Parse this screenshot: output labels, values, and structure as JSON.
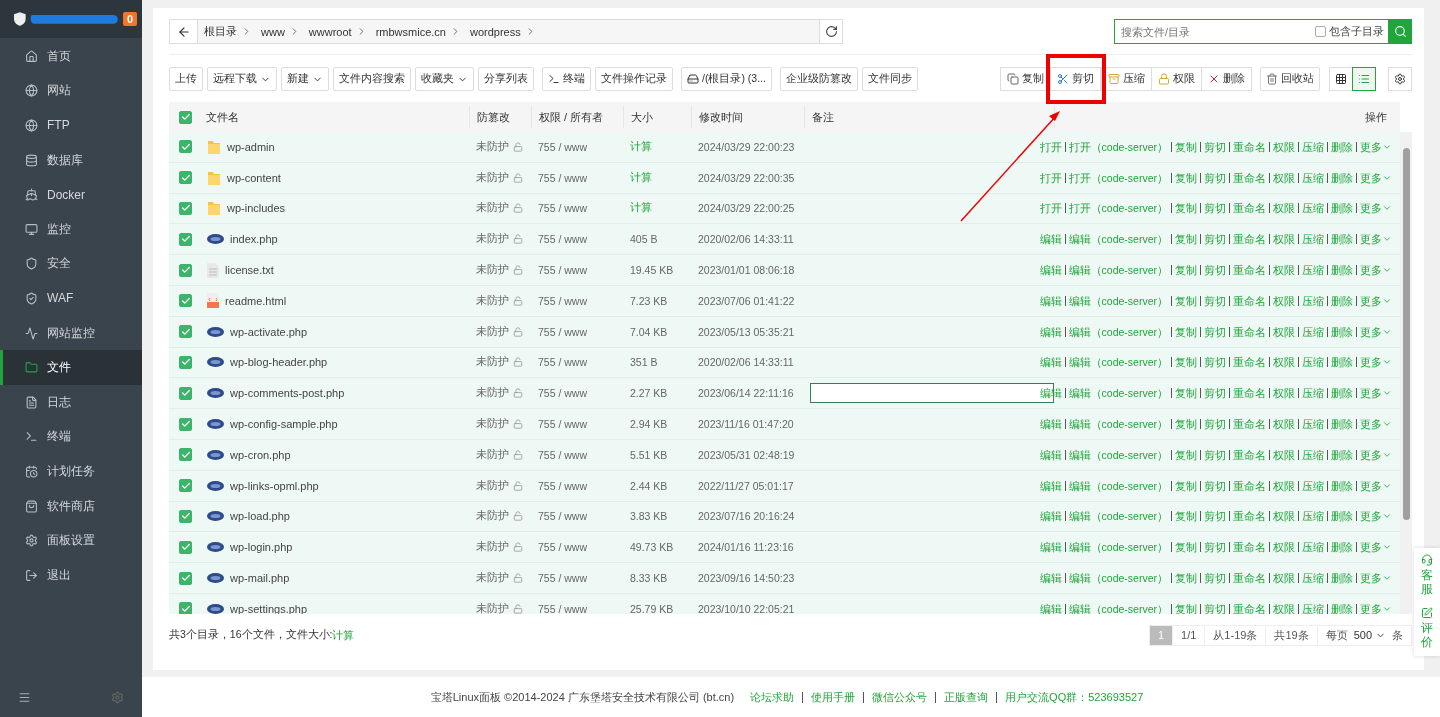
{
  "sidebar": {
    "badge": "0",
    "items": [
      {
        "label": "首页",
        "selected": false
      },
      {
        "label": "网站",
        "selected": false
      },
      {
        "label": "FTP",
        "selected": false
      },
      {
        "label": "数据库",
        "selected": false
      },
      {
        "label": "Docker",
        "selected": false
      },
      {
        "label": "监控",
        "selected": false
      },
      {
        "label": "安全",
        "selected": false
      },
      {
        "label": "WAF",
        "selected": false
      },
      {
        "label": "网站监控",
        "selected": false
      },
      {
        "label": "文件",
        "selected": true
      },
      {
        "label": "日志",
        "selected": false
      },
      {
        "label": "终端",
        "selected": false
      },
      {
        "label": "计划任务",
        "selected": false
      },
      {
        "label": "软件商店",
        "selected": false
      },
      {
        "label": "面板设置",
        "selected": false
      },
      {
        "label": "退出",
        "selected": false
      }
    ]
  },
  "breadcrumb": [
    "根目录",
    "www",
    "wwwroot",
    "rmbwsmice.cn",
    "wordpress"
  ],
  "search": {
    "placeholder": "搜索文件/目录",
    "include_subdirs": {
      "label": "包含子目录",
      "checked": false
    }
  },
  "toolbar": {
    "left": [
      {
        "label": "上传",
        "kind": "plain"
      },
      {
        "label": "远程下载",
        "kind": "dropdown"
      },
      {
        "label": "新建",
        "kind": "dropdown"
      },
      {
        "label": "文件内容搜索",
        "kind": "plain"
      },
      {
        "label": "收藏夹",
        "kind": "dropdown"
      },
      {
        "label": "分享列表",
        "kind": "plain"
      },
      {
        "label": "终端",
        "kind": "terminal"
      },
      {
        "label": "文件操作记录",
        "kind": "plain"
      },
      {
        "label": "/(根目录) (3...",
        "kind": "disk"
      },
      {
        "label": "企业级防篡改",
        "kind": "plain"
      },
      {
        "label": "文件同步",
        "kind": "plain"
      }
    ],
    "right": [
      {
        "label": "复制",
        "kind": "copy",
        "highlighted": false
      },
      {
        "label": "剪切",
        "kind": "cut",
        "highlighted": true
      },
      {
        "label": "压缩",
        "kind": "zip",
        "highlighted": false
      },
      {
        "label": "权限",
        "kind": "lock",
        "highlighted": false
      },
      {
        "label": "删除",
        "kind": "delete",
        "highlighted": false
      }
    ],
    "recycle": "回收站",
    "views": [
      {
        "kind": "grid",
        "selected": false
      },
      {
        "kind": "list",
        "selected": true
      }
    ]
  },
  "table": {
    "all_checked": true,
    "columns": [
      "文件名",
      "防篡改",
      "权限 / 所有者",
      "大小",
      "修改时间",
      "备注",
      "操作"
    ],
    "rows": [
      {
        "name": "wp-admin",
        "kind": "folder",
        "checked": true,
        "editing": false,
        "protect": "未防护",
        "perm": "755 / www",
        "size": "计算",
        "mtime": "2024/03/29 22:00:23",
        "actions": [
          "打开",
          "打开（code-server）",
          "复制",
          "剪切",
          "重命名",
          "权限",
          "压缩",
          "删除",
          "更多"
        ]
      },
      {
        "name": "wp-content",
        "kind": "folder",
        "checked": true,
        "editing": false,
        "protect": "未防护",
        "perm": "755 / www",
        "size": "计算",
        "mtime": "2024/03/29 22:00:35",
        "actions": [
          "打开",
          "打开（code-server）",
          "复制",
          "剪切",
          "重命名",
          "权限",
          "压缩",
          "删除",
          "更多"
        ]
      },
      {
        "name": "wp-includes",
        "kind": "folder",
        "checked": true,
        "editing": false,
        "protect": "未防护",
        "perm": "755 / www",
        "size": "计算",
        "mtime": "2024/03/29 22:00:25",
        "actions": [
          "打开",
          "打开（code-server）",
          "复制",
          "剪切",
          "重命名",
          "权限",
          "压缩",
          "删除",
          "更多"
        ]
      },
      {
        "name": "index.php",
        "kind": "php",
        "checked": true,
        "editing": false,
        "protect": "未防护",
        "perm": "755 / www",
        "size": "405 B",
        "mtime": "2020/02/06 14:33:11",
        "actions": [
          "编辑",
          "编辑（code-server）",
          "复制",
          "剪切",
          "重命名",
          "权限",
          "压缩",
          "删除",
          "更多"
        ]
      },
      {
        "name": "license.txt",
        "kind": "txt",
        "checked": true,
        "editing": false,
        "protect": "未防护",
        "perm": "755 / www",
        "size": "19.45 KB",
        "mtime": "2023/01/01 08:06:18",
        "actions": [
          "编辑",
          "编辑（code-server）",
          "复制",
          "剪切",
          "重命名",
          "权限",
          "压缩",
          "删除",
          "更多"
        ]
      },
      {
        "name": "readme.html",
        "kind": "html",
        "checked": true,
        "editing": false,
        "protect": "未防护",
        "perm": "755 / www",
        "size": "7.23 KB",
        "mtime": "2023/07/06 01:41:22",
        "actions": [
          "编辑",
          "编辑（code-server）",
          "复制",
          "剪切",
          "重命名",
          "权限",
          "压缩",
          "删除",
          "更多"
        ]
      },
      {
        "name": "wp-activate.php",
        "kind": "php",
        "checked": true,
        "editing": false,
        "protect": "未防护",
        "perm": "755 / www",
        "size": "7.04 KB",
        "mtime": "2023/05/13 05:35:21",
        "actions": [
          "编辑",
          "编辑（code-server）",
          "复制",
          "剪切",
          "重命名",
          "权限",
          "压缩",
          "删除",
          "更多"
        ]
      },
      {
        "name": "wp-blog-header.php",
        "kind": "php",
        "checked": true,
        "editing": false,
        "protect": "未防护",
        "perm": "755 / www",
        "size": "351 B",
        "mtime": "2020/02/06 14:33:11",
        "actions": [
          "编辑",
          "编辑（code-server）",
          "复制",
          "剪切",
          "重命名",
          "权限",
          "压缩",
          "删除",
          "更多"
        ]
      },
      {
        "name": "wp-comments-post.php",
        "kind": "php",
        "checked": true,
        "editing": true,
        "protect": "未防护",
        "perm": "755 / www",
        "size": "2.27 KB",
        "mtime": "2023/06/14 22:11:16",
        "actions": [
          "编辑",
          "编辑（code-server）",
          "复制",
          "剪切",
          "重命名",
          "权限",
          "压缩",
          "删除",
          "更多"
        ]
      },
      {
        "name": "wp-config-sample.php",
        "kind": "php",
        "checked": true,
        "editing": false,
        "protect": "未防护",
        "perm": "755 / www",
        "size": "2.94 KB",
        "mtime": "2023/11/16 01:47:20",
        "actions": [
          "编辑",
          "编辑（code-server）",
          "复制",
          "剪切",
          "重命名",
          "权限",
          "压缩",
          "删除",
          "更多"
        ]
      },
      {
        "name": "wp-cron.php",
        "kind": "php",
        "checked": true,
        "editing": false,
        "protect": "未防护",
        "perm": "755 / www",
        "size": "5.51 KB",
        "mtime": "2023/05/31 02:48:19",
        "actions": [
          "编辑",
          "编辑（code-server）",
          "复制",
          "剪切",
          "重命名",
          "权限",
          "压缩",
          "删除",
          "更多"
        ]
      },
      {
        "name": "wp-links-opml.php",
        "kind": "php",
        "checked": true,
        "editing": false,
        "protect": "未防护",
        "perm": "755 / www",
        "size": "2.44 KB",
        "mtime": "2022/11/27 05:01:17",
        "actions": [
          "编辑",
          "编辑（code-server）",
          "复制",
          "剪切",
          "重命名",
          "权限",
          "压缩",
          "删除",
          "更多"
        ]
      },
      {
        "name": "wp-load.php",
        "kind": "php",
        "checked": true,
        "editing": false,
        "protect": "未防护",
        "perm": "755 / www",
        "size": "3.83 KB",
        "mtime": "2023/07/16 20:16:24",
        "actions": [
          "编辑",
          "编辑（code-server）",
          "复制",
          "剪切",
          "重命名",
          "权限",
          "压缩",
          "删除",
          "更多"
        ]
      },
      {
        "name": "wp-login.php",
        "kind": "php",
        "checked": true,
        "editing": false,
        "protect": "未防护",
        "perm": "755 / www",
        "size": "49.73 KB",
        "mtime": "2024/01/16 11:23:16",
        "actions": [
          "编辑",
          "编辑（code-server）",
          "复制",
          "剪切",
          "重命名",
          "权限",
          "压缩",
          "删除",
          "更多"
        ]
      },
      {
        "name": "wp-mail.php",
        "kind": "php",
        "checked": true,
        "editing": false,
        "protect": "未防护",
        "perm": "755 / www",
        "size": "8.33 KB",
        "mtime": "2023/09/16 14:50:23",
        "actions": [
          "编辑",
          "编辑（code-server）",
          "复制",
          "剪切",
          "重命名",
          "权限",
          "压缩",
          "删除",
          "更多"
        ]
      },
      {
        "name": "wp-settings.php",
        "kind": "php",
        "checked": true,
        "editing": false,
        "protect": "未防护",
        "perm": "755 / www",
        "size": "25.79 KB",
        "mtime": "2023/10/10 22:05:21",
        "actions": [
          "编辑",
          "编辑（code-server）",
          "复制",
          "剪切",
          "重命名",
          "权限",
          "压缩",
          "删除",
          "更多"
        ]
      }
    ]
  },
  "summary": {
    "text": "共3个目录，16个文件，文件大小: ",
    "link": "计算"
  },
  "pagination": {
    "current": "1",
    "pages": "1/1",
    "range": "从1-19条",
    "total": "共19条",
    "per_page_label": "每页",
    "per_page": "500",
    "unit": "条"
  },
  "float_tools": [
    "客服",
    "评价"
  ],
  "footer": {
    "copyright": "宝塔Linux面板 ©2014-2024 广东堡塔安全技术有限公司 (bt.cn)",
    "links": [
      "论坛求助",
      "使用手册",
      "微信公众号",
      "正版查询",
      "用户交流QQ群：523693527"
    ]
  }
}
